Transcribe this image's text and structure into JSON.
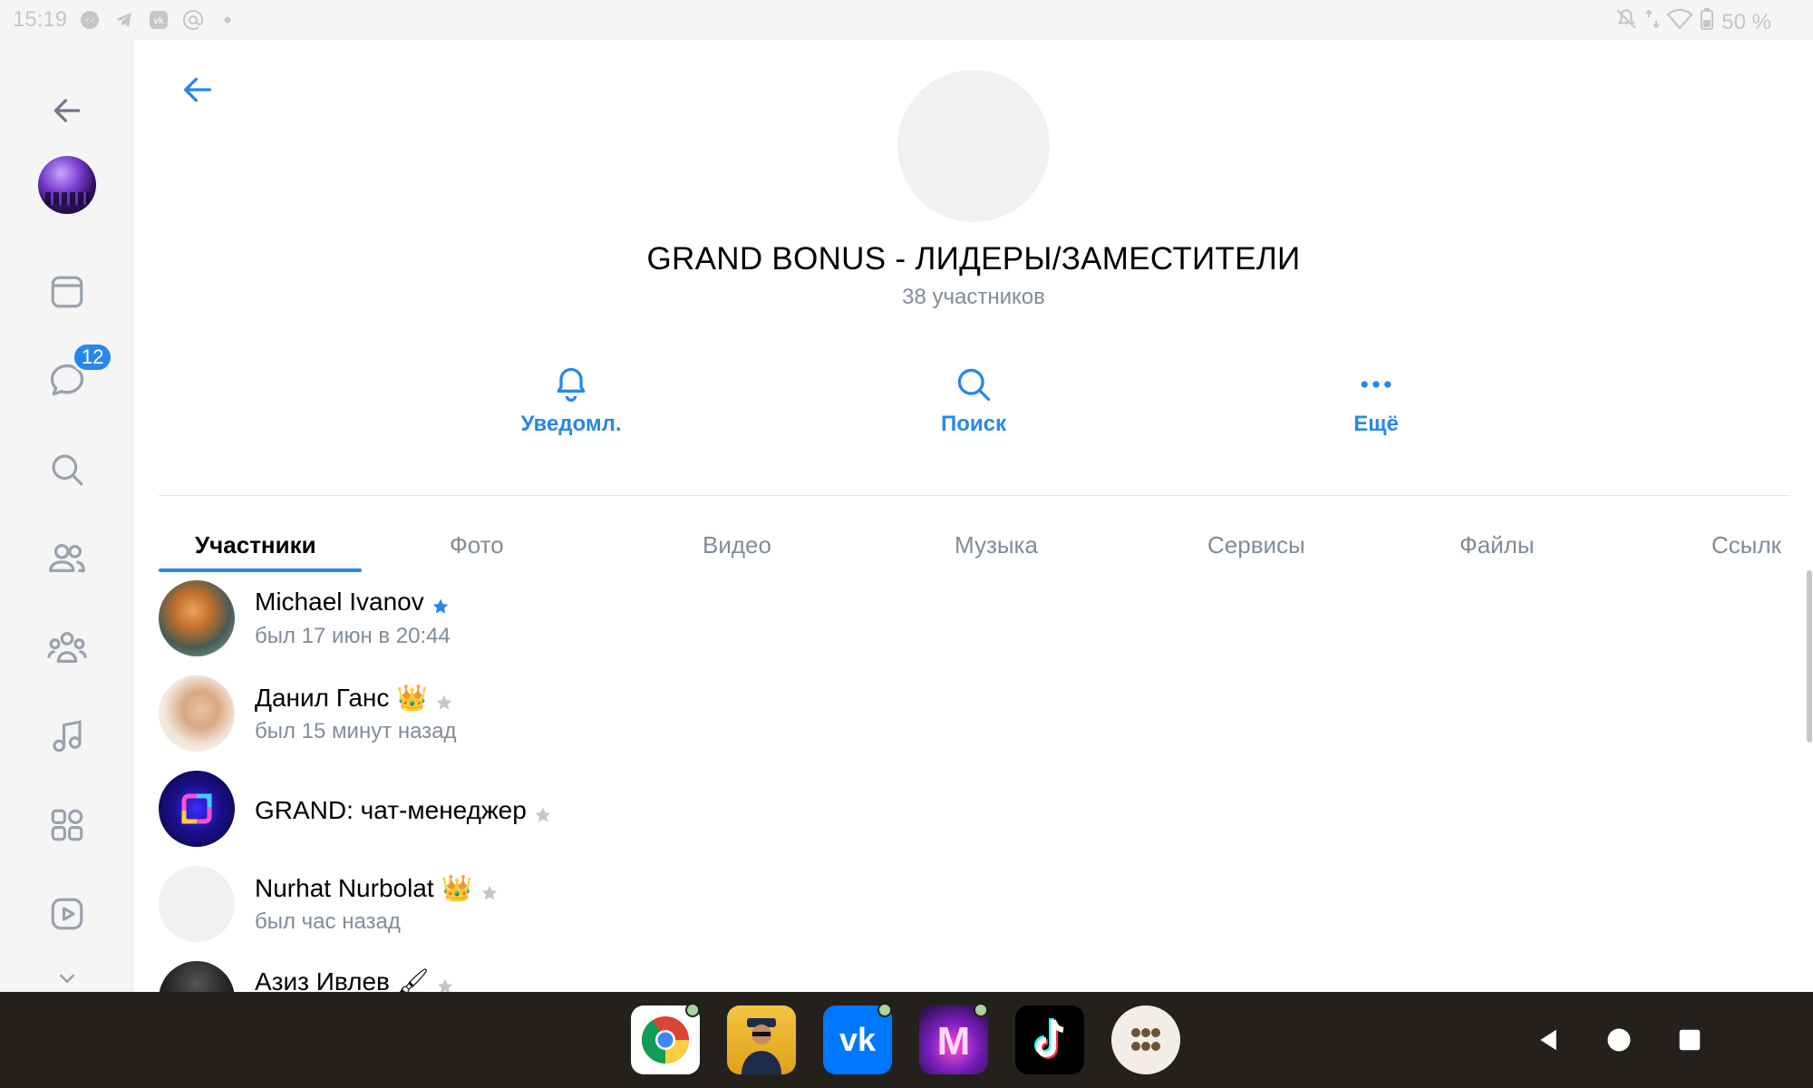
{
  "status_bar": {
    "time": "15:19",
    "battery": "50 %",
    "left_icons": [
      "messenger-icon",
      "telegram-icon",
      "vk-icon",
      "at-icon",
      "dot-icon"
    ],
    "right_icons": [
      "dnd-icon",
      "data-icon",
      "wifi-icon",
      "battery-icon"
    ]
  },
  "sidebar": {
    "messages_badge": "12",
    "items": [
      "back-icon",
      "profile-avatar",
      "feed-icon",
      "messages-icon",
      "search-icon",
      "friends-icon",
      "communities-icon",
      "music-icon",
      "services-icon",
      "video-icon",
      "more-icon"
    ]
  },
  "chat": {
    "title": "GRAND BONUS - ЛИДЕРЫ/ЗАМЕСТИТЕЛИ",
    "subtitle": "38 участников",
    "actions": [
      {
        "label": "Уведомл.",
        "icon": "bell-icon"
      },
      {
        "label": "Поиск",
        "icon": "search-icon"
      },
      {
        "label": "Ещё",
        "icon": "more-dots-icon"
      }
    ]
  },
  "tabs": [
    "Участники",
    "Фото",
    "Видео",
    "Музыка",
    "Сервисы",
    "Файлы",
    "Ссылк"
  ],
  "members": [
    {
      "name": "Michael Ivanov",
      "status": "был 17 июн в 20:44",
      "star": "blue"
    },
    {
      "name": "Данил Ганс",
      "emoji": "👑",
      "status": "был 15 минут назад",
      "star": "gray"
    },
    {
      "name": "GRAND: чат-менеджер",
      "status": "",
      "star": "gray"
    },
    {
      "name": "Nurhat Nurbolat",
      "emoji": "👑",
      "status": "был час назад",
      "star": "gray"
    },
    {
      "name": "Азиз Ивлев",
      "emoji": "🖌",
      "status": "",
      "star": "gray"
    }
  ],
  "dock": {
    "apps": [
      "chrome-icon",
      "game-police-icon",
      "vk-app-icon",
      "music-app-icon",
      "tiktok-icon",
      "app-drawer-icon"
    ],
    "system": [
      "back-nav-icon",
      "home-nav-icon",
      "recents-nav-icon"
    ]
  },
  "colors": {
    "accent": "#2688eb",
    "secondary_text": "#818c99",
    "navbar": "#24201b"
  }
}
